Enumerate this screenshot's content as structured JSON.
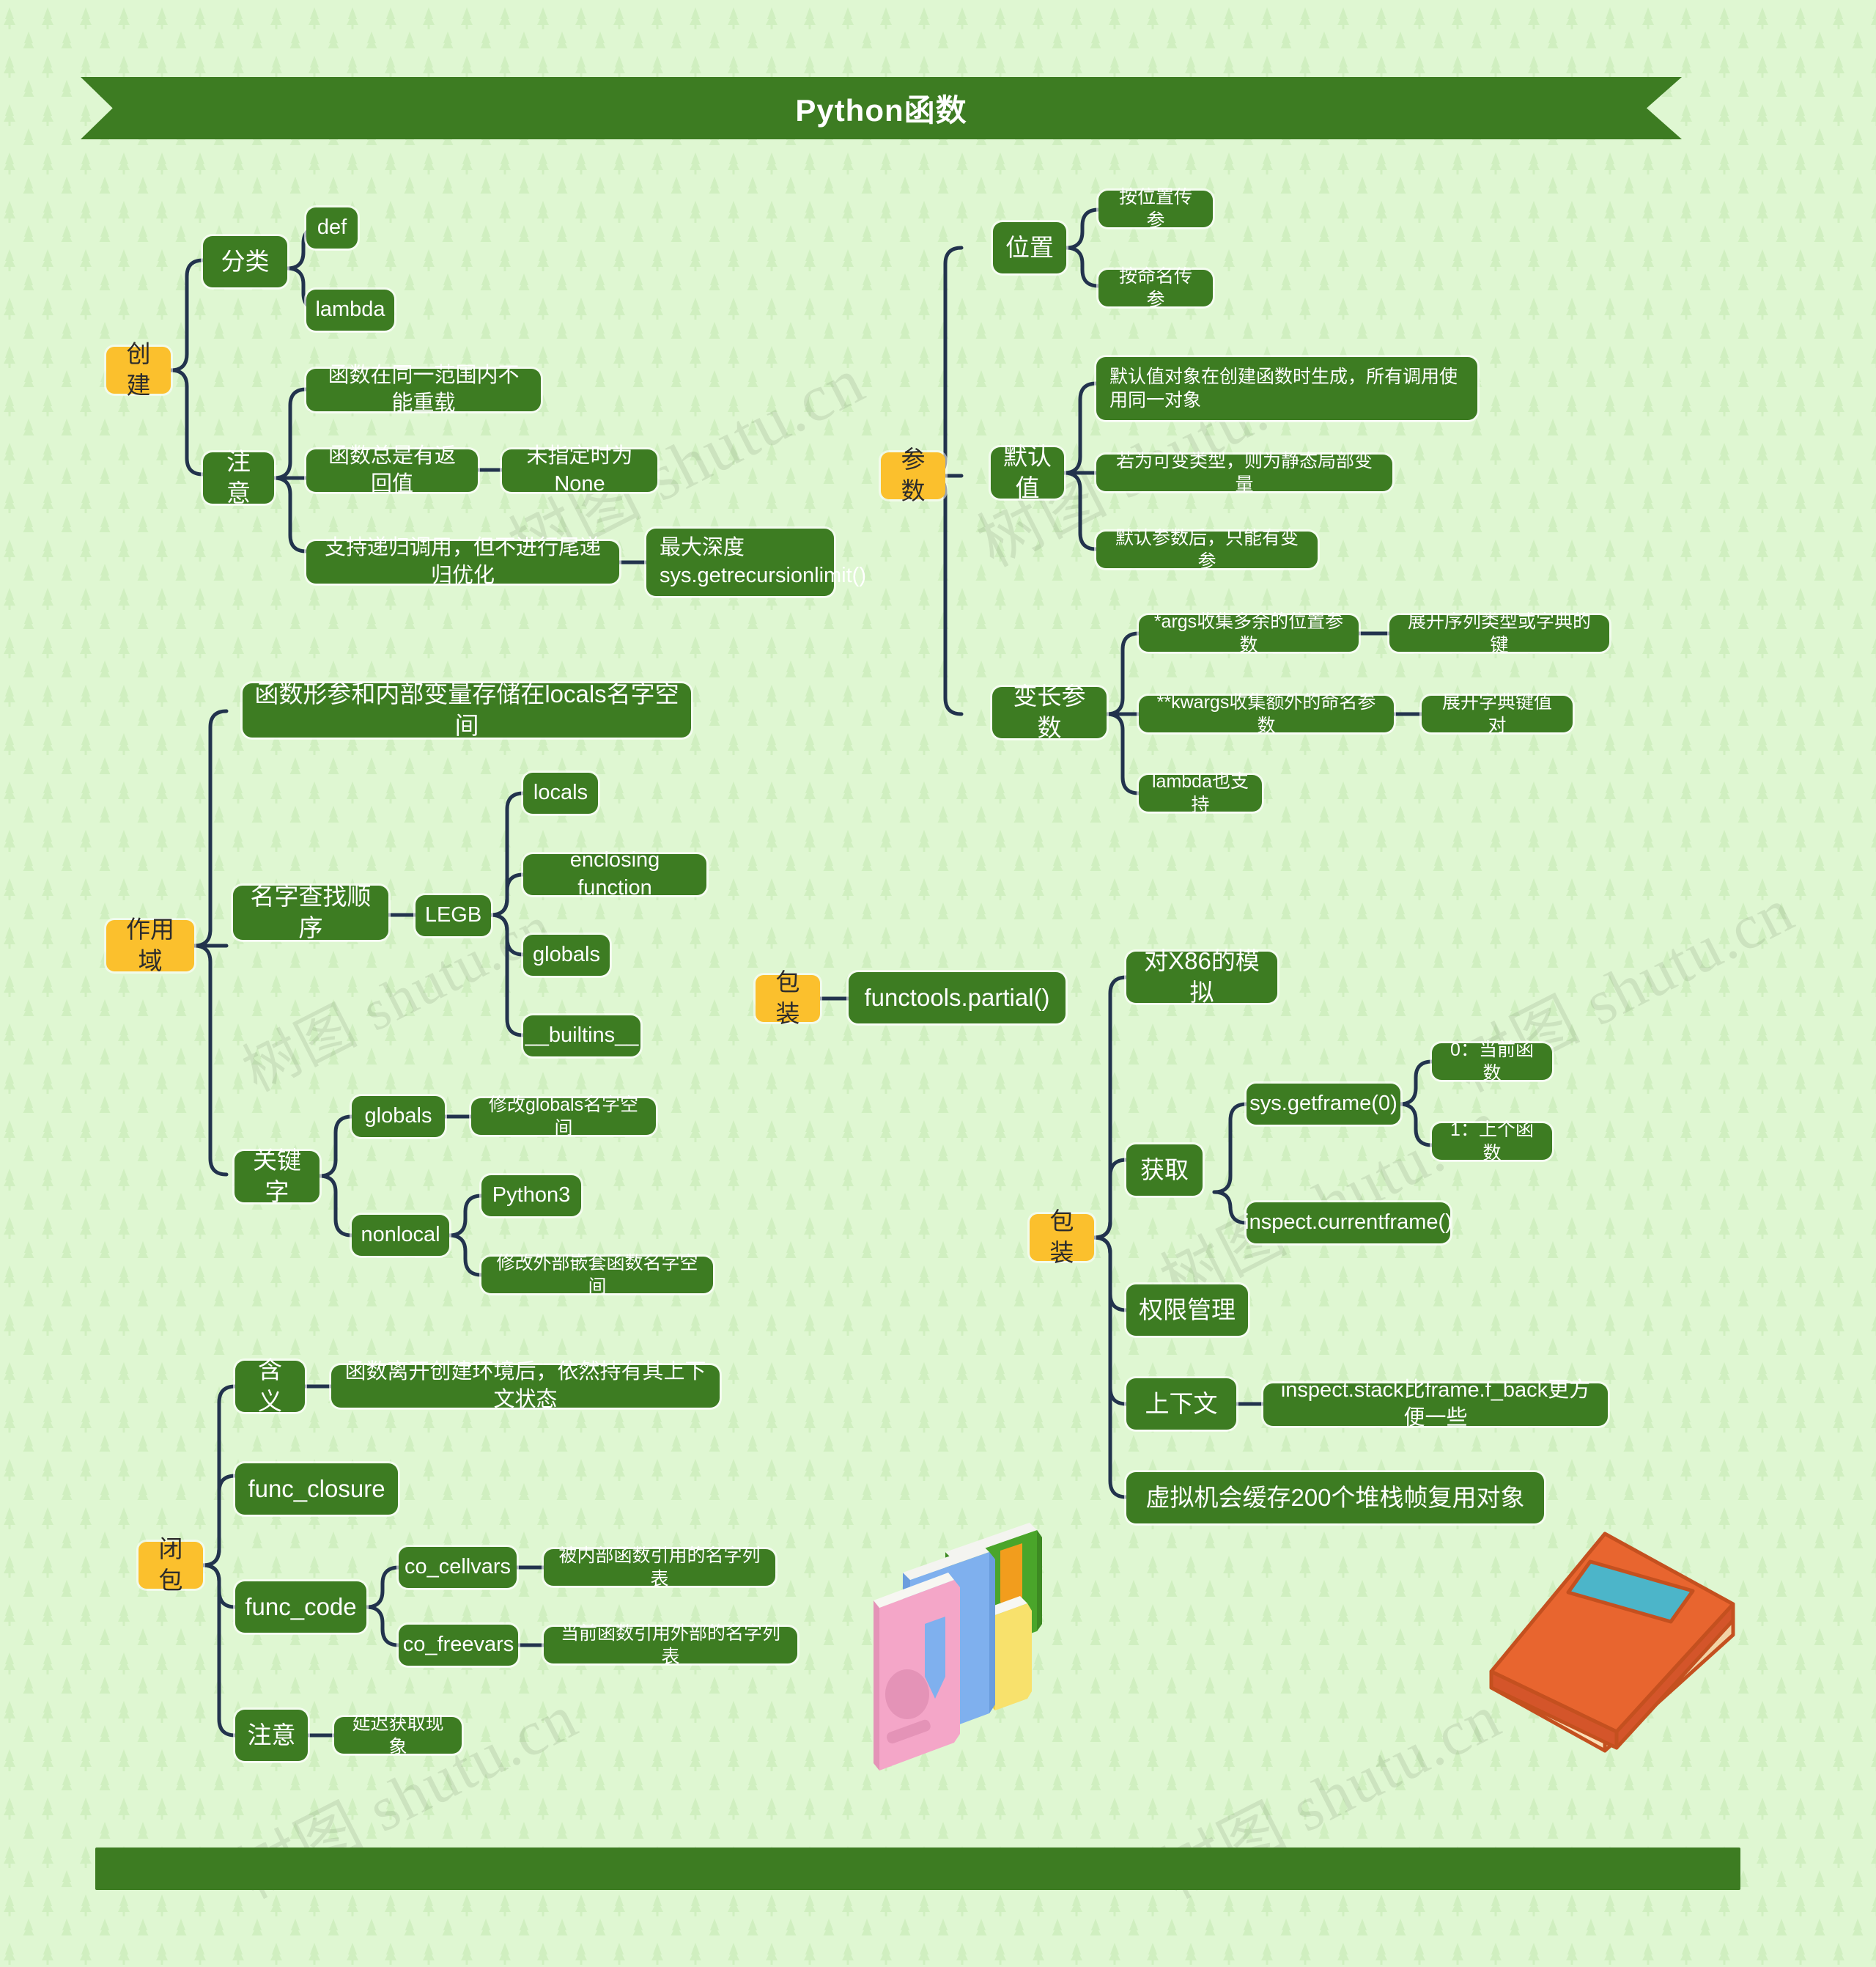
{
  "title": "Python函数",
  "watermarks": [
    "树图 shutu.cn",
    "树图 shutu.cn",
    "树图 shutu.cn",
    "树图 shutu.cn",
    "树图 shutu.cn",
    "树图 shutu.cn",
    "树图 shutu.cn"
  ],
  "branches": {
    "create": {
      "label": "创建",
      "classify": {
        "label": "分类",
        "children": [
          "def",
          "lambda"
        ]
      },
      "notice": {
        "label": "注意",
        "children": [
          {
            "label": "函数在同一范围内不能重载"
          },
          {
            "label": "函数总是有返回值",
            "child": "未指定时为None"
          },
          {
            "label": "支持递归调用，但不进行尾递归优化",
            "child": "最大深度sys.getrecursionlimit()"
          }
        ]
      }
    },
    "params": {
      "label": "参数",
      "position": {
        "label": "位置",
        "children": [
          "按位置传参",
          "按命名传参"
        ]
      },
      "default": {
        "label": "默认值",
        "children": [
          "默认值对象在创建函数时生成，所有调用使用同一对象",
          "若为可变类型，则为静态局部变量",
          "默认参数后，只能有变参"
        ]
      },
      "varargs": {
        "label": "变长参数",
        "children": [
          {
            "label": "*args收集多余的位置参数",
            "child": "展开序列类型或字典的键"
          },
          {
            "label": "**kwargs收集额外的命名参数",
            "child": "展开字典键值对"
          },
          {
            "label": "lambda也支持"
          }
        ]
      }
    },
    "scope": {
      "label": "作用域",
      "locals_note": "函数形参和内部变量存储在locals名字空间",
      "lookup": {
        "label": "名字查找顺序",
        "legb": "LEGB",
        "children": [
          "locals",
          "enclosing function",
          "globals",
          "__builtins__"
        ]
      },
      "keywords": {
        "label": "关键字",
        "globals": {
          "label": "globals",
          "child": "修改globals名字空间"
        },
        "nonlocal": {
          "label": "nonlocal",
          "children": [
            "Python3",
            "修改外部嵌套函数名字空间"
          ]
        }
      }
    },
    "closure": {
      "label": "闭包",
      "meaning": {
        "label": "含义",
        "child": "函数离开创建环境后，依然持有其上下文状态"
      },
      "func_closure": "func_closure",
      "func_code": {
        "label": "func_code",
        "children": [
          {
            "label": "co_cellvars",
            "child": "被内部函数引用的名字列表"
          },
          {
            "label": "co_freevars",
            "child": "当前函数引用外部的名字列表"
          }
        ]
      },
      "notice": {
        "label": "注意",
        "child": "延迟获取现象"
      }
    },
    "wrap_partial": {
      "label": "包装",
      "child": "functools.partial()"
    },
    "wrap_frame": {
      "label": "包装",
      "children": [
        {
          "label": "对X86的模拟"
        },
        {
          "label": "获取",
          "children": [
            {
              "label": "sys.getframe(0)",
              "children": [
                "0：当前函数",
                "1：上个函数"
              ]
            },
            {
              "label": "inspect.currentframe()"
            }
          ]
        },
        {
          "label": "权限管理"
        },
        {
          "label": "上下文",
          "child": "inspect.stack比frame.f_back更方便一些"
        },
        {
          "label": "虚拟机会缓存200个堆栈帧复用对象"
        }
      ]
    }
  },
  "colors": {
    "node_green": "#3d7c22",
    "node_yellow": "#fbc02d",
    "background": "#dff7d2",
    "link": "#22334d",
    "banner": "#3d7c22"
  }
}
